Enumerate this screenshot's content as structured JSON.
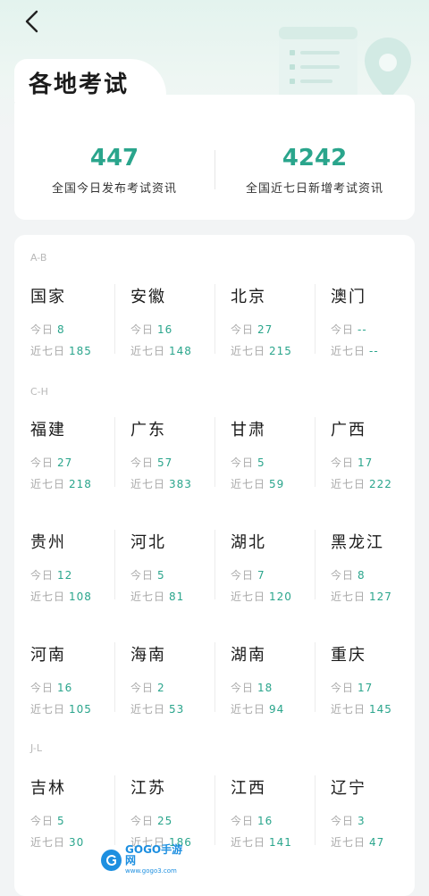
{
  "header": {
    "title": "各地考试"
  },
  "summary": {
    "today": {
      "value": "447",
      "label": "全国今日发布考试资讯"
    },
    "week": {
      "value": "4242",
      "label": "全国近七日新增考试资讯"
    }
  },
  "labels": {
    "today": "今日",
    "week": "近七日"
  },
  "sections": [
    {
      "label": "A-B"
    },
    {
      "label": "C-H"
    },
    {
      "label": "J-L"
    }
  ],
  "regions": [
    {
      "name": "国家",
      "today": "8",
      "week": "185"
    },
    {
      "name": "安徽",
      "today": "16",
      "week": "148"
    },
    {
      "name": "北京",
      "today": "27",
      "week": "215"
    },
    {
      "name": "澳门",
      "today": "--",
      "week": "--"
    },
    {
      "name": "福建",
      "today": "27",
      "week": "218"
    },
    {
      "name": "广东",
      "today": "57",
      "week": "383"
    },
    {
      "name": "甘肃",
      "today": "5",
      "week": "59"
    },
    {
      "name": "广西",
      "today": "17",
      "week": "222"
    },
    {
      "name": "贵州",
      "today": "12",
      "week": "108"
    },
    {
      "name": "河北",
      "today": "5",
      "week": "81"
    },
    {
      "name": "湖北",
      "today": "7",
      "week": "120"
    },
    {
      "name": "黑龙江",
      "today": "8",
      "week": "127"
    },
    {
      "name": "河南",
      "today": "16",
      "week": "105"
    },
    {
      "name": "海南",
      "today": "2",
      "week": "53"
    },
    {
      "name": "湖南",
      "today": "18",
      "week": "94"
    },
    {
      "name": "重庆",
      "today": "17",
      "week": "145"
    },
    {
      "name": "吉林",
      "today": "5",
      "week": "30"
    },
    {
      "name": "江苏",
      "today": "25",
      "week": "186"
    },
    {
      "name": "江西",
      "today": "16",
      "week": "141"
    },
    {
      "name": "辽宁",
      "today": "3",
      "week": "47"
    }
  ],
  "watermark": {
    "brand": "GOGO手游网",
    "site": "www.gogo3.com"
  },
  "colors": {
    "accent": "#2aa58c",
    "muted": "#aaaaaa",
    "background": "#f2f4f5"
  }
}
